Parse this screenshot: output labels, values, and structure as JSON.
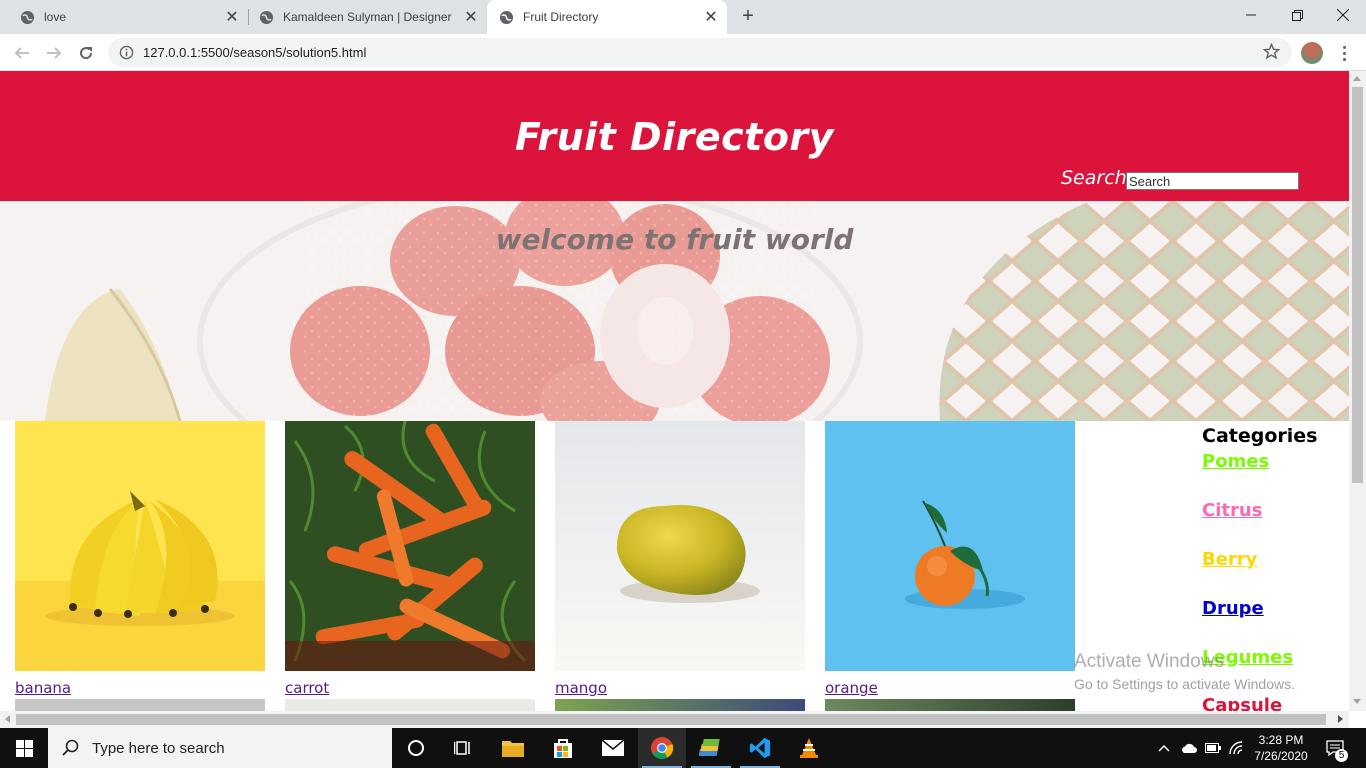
{
  "browser": {
    "tabs": [
      {
        "title": "love",
        "active": false
      },
      {
        "title": "Kamaldeen Sulyman | Designer",
        "active": false
      },
      {
        "title": "Fruit Directory",
        "active": true
      }
    ],
    "url": "127.0.0.1:5500/season5/solution5.html"
  },
  "page": {
    "title": "Fruit Directory",
    "search_label": "Search",
    "search_placeholder": "Search",
    "hero_text": "welcome to fruit world",
    "fruits": [
      {
        "name": "banana",
        "bg": "#fde24a"
      },
      {
        "name": "carrot",
        "bg": "#3d6b2a"
      },
      {
        "name": "mango",
        "bg": "#ecebe9"
      },
      {
        "name": "orange",
        "bg": "#5bc0ef"
      }
    ],
    "categories_title": "Categories",
    "categories": [
      {
        "label": "Pomes",
        "color": "#7cfc00"
      },
      {
        "label": "Citrus",
        "color": "#ff69b4"
      },
      {
        "label": "Berry",
        "color": "#ffd700"
      },
      {
        "label": "Drupe",
        "color": "#0000cd"
      },
      {
        "label": "Legumes",
        "color": "#7cfc00"
      },
      {
        "label": "Capsule",
        "color": "#dc143c"
      }
    ],
    "header_color": "#dc143c"
  },
  "watermark": {
    "line1": "Activate Windows",
    "line2": "Go to Settings to activate Windows."
  },
  "taskbar": {
    "search_placeholder": "Type here to search",
    "time": "3:28 PM",
    "date": "7/26/2020",
    "notification_count": "5"
  }
}
